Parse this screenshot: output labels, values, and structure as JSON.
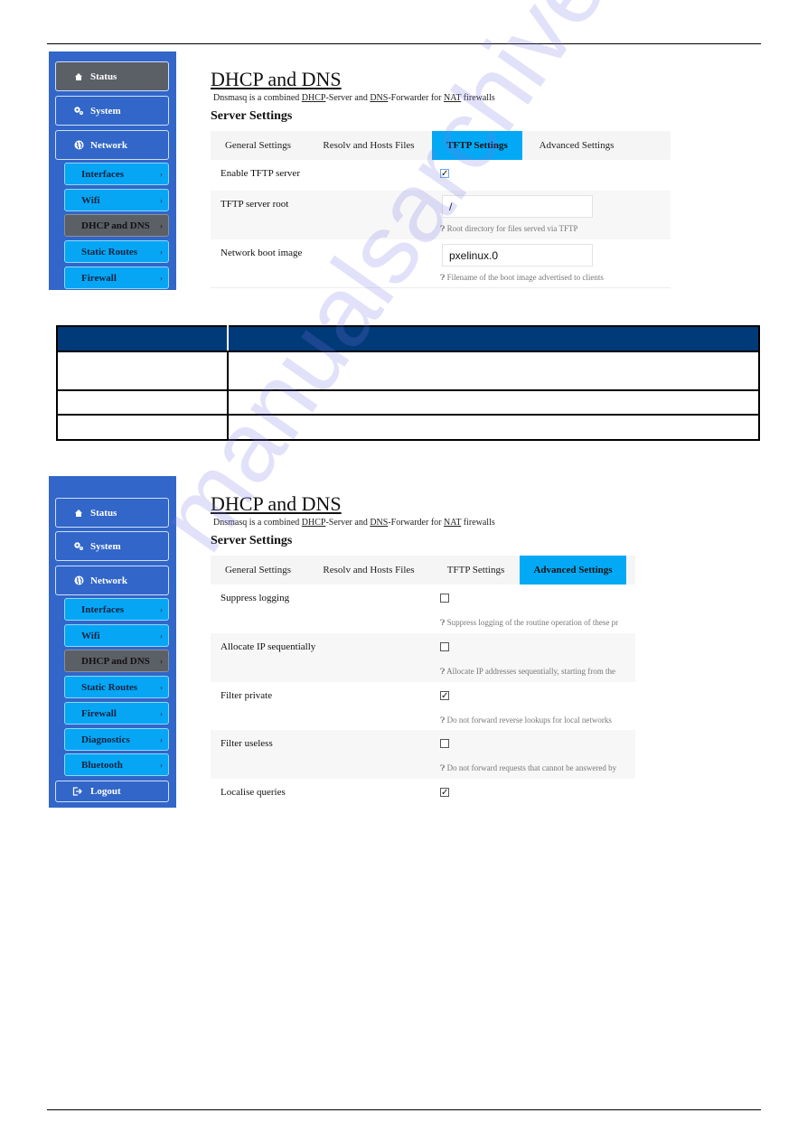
{
  "sidebar_top": {
    "main": [
      {
        "label": "Status",
        "icon": "home-icon",
        "active": true
      },
      {
        "label": "System",
        "icon": "gears-icon",
        "active": false
      },
      {
        "label": "Network",
        "icon": "globe-icon",
        "active": false
      }
    ],
    "sub": [
      {
        "label": "Interfaces",
        "active": false
      },
      {
        "label": "Wifi",
        "active": false
      },
      {
        "label": "DHCP and DNS",
        "active": true
      },
      {
        "label": "Static Routes",
        "active": false
      },
      {
        "label": "Firewall",
        "active": false
      }
    ]
  },
  "sidebar_bottom": {
    "main": [
      {
        "label": "Status",
        "icon": "home-icon",
        "active": false
      },
      {
        "label": "System",
        "icon": "gears-icon",
        "active": false
      },
      {
        "label": "Network",
        "icon": "globe-icon",
        "active": false
      }
    ],
    "sub": [
      {
        "label": "Interfaces",
        "active": false
      },
      {
        "label": "Wifi",
        "active": false
      },
      {
        "label": "DHCP and DNS",
        "active": true
      },
      {
        "label": "Static Routes",
        "active": false
      },
      {
        "label": "Firewall",
        "active": false
      },
      {
        "label": "Diagnostics",
        "active": false
      },
      {
        "label": "Bluetooth",
        "active": false
      }
    ],
    "logout": "Logout"
  },
  "page": {
    "title": "DHCP and DNS",
    "desc_prefix": "Dnsmasq is a combined ",
    "desc_dhcp": "DHCP",
    "desc_mid1": "-Server and ",
    "desc_dns": "DNS",
    "desc_mid2": "-Forwarder for ",
    "desc_nat": "NAT",
    "desc_suffix": " firewalls",
    "section": "Server Settings",
    "chevron": "›",
    "tabs": [
      "General Settings",
      "Resolv and Hosts Files",
      "TFTP Settings",
      "Advanced Settings"
    ]
  },
  "tftp": {
    "active_tab": "TFTP Settings",
    "enable_label": "Enable TFTP server",
    "enable_checked": true,
    "root_label": "TFTP server root",
    "root_value": "/",
    "root_hint": "Root directory for files served via TFTP",
    "boot_label": "Network boot image",
    "boot_value": "pxelinux.0",
    "boot_hint": "Filename of the boot image advertised to clients"
  },
  "advanced": {
    "active_tab": "Advanced Settings",
    "rows": [
      {
        "label": "Suppress logging",
        "checked": false,
        "hint": "Suppress logging of the routine operation of these pr"
      },
      {
        "label": "Allocate IP sequentially",
        "checked": false,
        "hint": "Allocate IP addresses sequentially, starting from the"
      },
      {
        "label": "Filter private",
        "checked": true,
        "hint": "Do not forward reverse lookups for local networks"
      },
      {
        "label": "Filter useless",
        "checked": false,
        "hint": "Do not forward requests that cannot be answered by"
      },
      {
        "label": "Localise queries",
        "checked": true,
        "hint": ""
      }
    ]
  },
  "hint_icon": "question-circle-icon",
  "check_glyph": "✓",
  "watermark": "manualsarchive.com",
  "colors": {
    "sidebar_bg": "#3266c8",
    "sub_item_bg": "#06a6f5",
    "active_item_bg": "#5b5f66",
    "active_tab_bg": "#03a9f4",
    "table_header_bg": "#003a78"
  }
}
